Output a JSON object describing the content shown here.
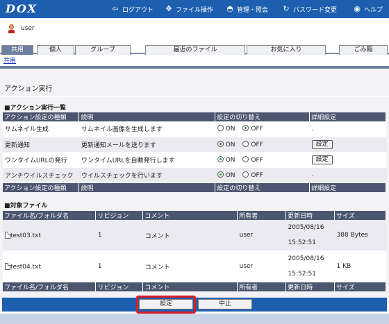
{
  "app": {
    "logo": "DOX"
  },
  "topnav": [
    {
      "label": "ログアウト",
      "icon": "logout-icon",
      "glyph": "⇦"
    },
    {
      "label": "ファイル操作",
      "icon": "file-ops-icon",
      "glyph": "✥"
    },
    {
      "label": "管理・照会",
      "icon": "admin-icon",
      "glyph": "◓"
    },
    {
      "label": "パスワード変更",
      "icon": "password-icon",
      "glyph": "↻"
    },
    {
      "label": "ヘルプ",
      "icon": "help-icon",
      "glyph": "◉"
    }
  ],
  "user": {
    "name": "user"
  },
  "tabs": [
    {
      "label": "共用",
      "active": true
    },
    {
      "label": "個人"
    },
    {
      "label": "グループ"
    },
    {
      "label": "最近のファイル"
    },
    {
      "label": "お気に入り"
    },
    {
      "label": "ごみ箱"
    }
  ],
  "breadcrumb": "共用",
  "panel": {
    "title": "アクション実行",
    "actions_section": "■アクション実行一覧",
    "files_section": "■対象ファイル"
  },
  "action_table": {
    "headers": [
      "アクション設定の種類",
      "説明",
      "設定の切り替え",
      "詳細設定"
    ],
    "rows": [
      {
        "type": "サムネイル生成",
        "desc": "サムネイル画像を生成します",
        "on": "ON",
        "off": "OFF",
        "selected": "off",
        "detail": "."
      },
      {
        "type": "更新通知",
        "desc": "更新通知メールを送ります",
        "on": "ON",
        "off": "OFF",
        "selected": "on",
        "detail": "設定"
      },
      {
        "type": "ワンタイムURLの発行",
        "desc": "ワンタイムURLを自動発行します",
        "on": "ON",
        "off": "OFF",
        "selected": "on",
        "detail": "設定"
      },
      {
        "type": "アンチウイルスチェック",
        "desc": "ウイルスチェックを行います",
        "on": "ON",
        "off": "OFF",
        "selected": "on",
        "detail": "."
      }
    ]
  },
  "file_table": {
    "headers": [
      "ファイル名/フォルダ名",
      "リビジョン",
      "コメント",
      "所有者",
      "更新日時",
      "サイズ"
    ],
    "rows": [
      {
        "name": "test03.txt",
        "revision": "1",
        "comment": "コメント",
        "owner": "user",
        "date": "2005/08/16",
        "time": "15:52:51",
        "size": "388 Bytes"
      },
      {
        "name": "test04.txt",
        "revision": "1",
        "comment": "コメント",
        "owner": "user",
        "date": "2005/08/16",
        "time": "15:52:51",
        "size": "1 KB"
      }
    ]
  },
  "footer": {
    "ok_label": "設定",
    "cancel_label": "中止"
  }
}
